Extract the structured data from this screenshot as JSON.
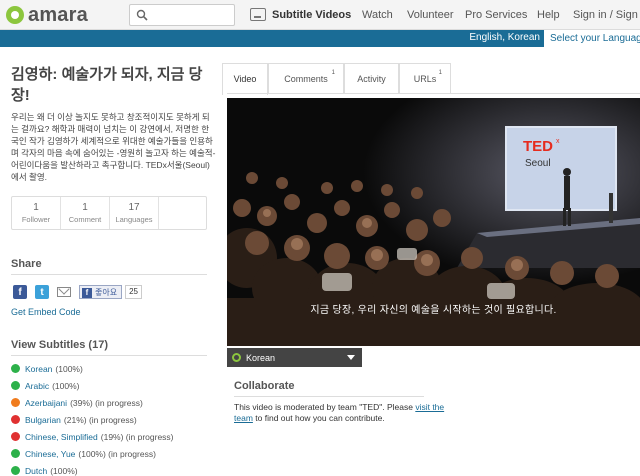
{
  "header": {
    "logo_text": "amara",
    "search_placeholder": "",
    "subtitle_videos": "Subtitle Videos",
    "nav": [
      "Watch",
      "Volunteer",
      "Pro Services",
      "Help",
      "Sign in / Sign u"
    ]
  },
  "langbar": {
    "current": "English, Korean",
    "select_label": "Select your Languages"
  },
  "video_info": {
    "title": "김영하: 예술가가 되자, 지금 당장!",
    "description": "우리는 왜 더 이상 놀지도 못하고 창조적이지도 못하게 되는 걸까요? 해학과 매력이 넘치는 이 강연에서, 저명한 한국인 작가 김영하가 세계적으로 위대한 예술가들을 인용하며 각자의 마음 속에 숨어있는 -영원히 놀고자 하는 예술적- 어린이다움을 발산하라고 촉구합니다. TEDx서울(Seoul)에서 촬영.",
    "stats": [
      {
        "number": "1",
        "label": "Follower"
      },
      {
        "number": "1",
        "label": "Comment"
      },
      {
        "number": "17",
        "label": "Languages"
      }
    ]
  },
  "share": {
    "heading": "Share",
    "like_label": "좋아요",
    "like_count": "25",
    "embed_link": "Get Embed Code"
  },
  "subtitles": {
    "heading": "View Subtitles (17)",
    "items": [
      {
        "name": "Korean",
        "status": "(100%)",
        "color": "#2db14a"
      },
      {
        "name": "Arabic",
        "status": "(100%)",
        "color": "#2db14a"
      },
      {
        "name": "Azerbaijani",
        "status": "(39%) (in progress)",
        "color": "#f07c1e"
      },
      {
        "name": "Bulgarian",
        "status": "(21%) (in progress)",
        "color": "#e03131"
      },
      {
        "name": "Chinese, Simplified",
        "status": "(19%) (in progress)",
        "color": "#e03131"
      },
      {
        "name": "Chinese, Yue",
        "status": "(100%) (in progress)",
        "color": "#2db14a"
      },
      {
        "name": "Dutch",
        "status": "(100%)",
        "color": "#2db14a"
      }
    ]
  },
  "tabs": [
    {
      "label": "Video",
      "count": ""
    },
    {
      "label": "Comments",
      "count": "1"
    },
    {
      "label": "Activity",
      "count": ""
    },
    {
      "label": "URLs",
      "count": "1"
    }
  ],
  "player": {
    "caption": "지금 당장, 우리 자신의 예술을 시작하는 것이 필요합니다.",
    "screen_text_brand": "TED",
    "screen_text_x": "x",
    "screen_text_city": "Seoul",
    "subtitle_language": "Korean"
  },
  "collaborate": {
    "heading": "Collaborate",
    "text_before": "This video is moderated by team \"TED\". Please ",
    "link_text": "visit the team",
    "text_after": " to find out how you can contribute."
  },
  "colors": {
    "accent": "#1a6c96",
    "logo_green": "#8cc63e"
  }
}
